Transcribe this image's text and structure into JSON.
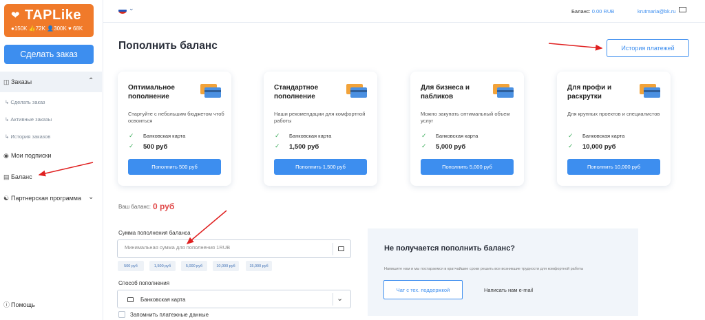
{
  "sidebar": {
    "logo": {
      "title": "TAPLike",
      "stats": "●150K 👍72K 👤300K ♥ 68K"
    },
    "order_button": "Сделать заказ",
    "sections": {
      "orders": "Заказы",
      "make_order": "Сделать заказ",
      "active_orders": "Активные заказы",
      "order_history": "История заказов",
      "subscriptions": "Мои подписки",
      "balance": "Баланс",
      "partner": "Партнерская программа",
      "help": "Помощь"
    }
  },
  "topbar": {
    "balance_label": "Баланс:",
    "balance_value": "0.00 RUB",
    "email": "krutmaria@bk.ru"
  },
  "main": {
    "title": "Пополнить баланс",
    "history_button": "История платежей",
    "cards": [
      {
        "title": "Оптимальное пополнение",
        "desc": "Стартуйте с небольшим бюджетом чтоб освоиться",
        "method": "Банковская карта",
        "price": "500 руб",
        "button": "Пополнить 500 руб"
      },
      {
        "title": "Стандартное пополнение",
        "desc": "Наши рекомендации для комфортной работы",
        "method": "Банковская карта",
        "price": "1,500 руб",
        "button": "Пополнить 1,500 руб"
      },
      {
        "title": "Для бизнеса и пабликов",
        "desc": "Можно закупать оптимальный объем услуг",
        "method": "Банковская карта",
        "price": "5,000 руб",
        "button": "Пополнить 5,000 руб"
      },
      {
        "title": "Для профи и раскрутки",
        "desc": "Для крупных проектов и специалистов",
        "method": "Банковская карта",
        "price": "10,000 руб",
        "button": "Пополнить 10,000 руб"
      }
    ],
    "your_balance_label": "Ваш баланс:",
    "your_balance_value": "0 руб",
    "amount_label": "Сумма пополнения баланса",
    "amount_placeholder": "Минимальная сумма для пополнения 1RUB",
    "amount_chips": [
      "500 руб",
      "1,500 руб",
      "5,000 руб",
      "10,000 руб",
      "15,000 руб"
    ],
    "method_label": "Способ пополнения",
    "method_value": "Банковская карта",
    "remember_label": "Запомнить платежные данные"
  },
  "help": {
    "title": "Не получается пополнить баланс?",
    "desc": "Напишите нам и мы постараемся в кратчайшие сроки решить все возникшие трудности для комфортной работы",
    "chat_button": "Чат с тех. поддержкой",
    "email_link": "Написать нам e-mail"
  },
  "colors": {
    "accent": "#3d8eef",
    "logo": "#f07a2a",
    "balance_red": "#e04848",
    "arrow_red": "#e02020",
    "check_green": "#3fae5e"
  }
}
